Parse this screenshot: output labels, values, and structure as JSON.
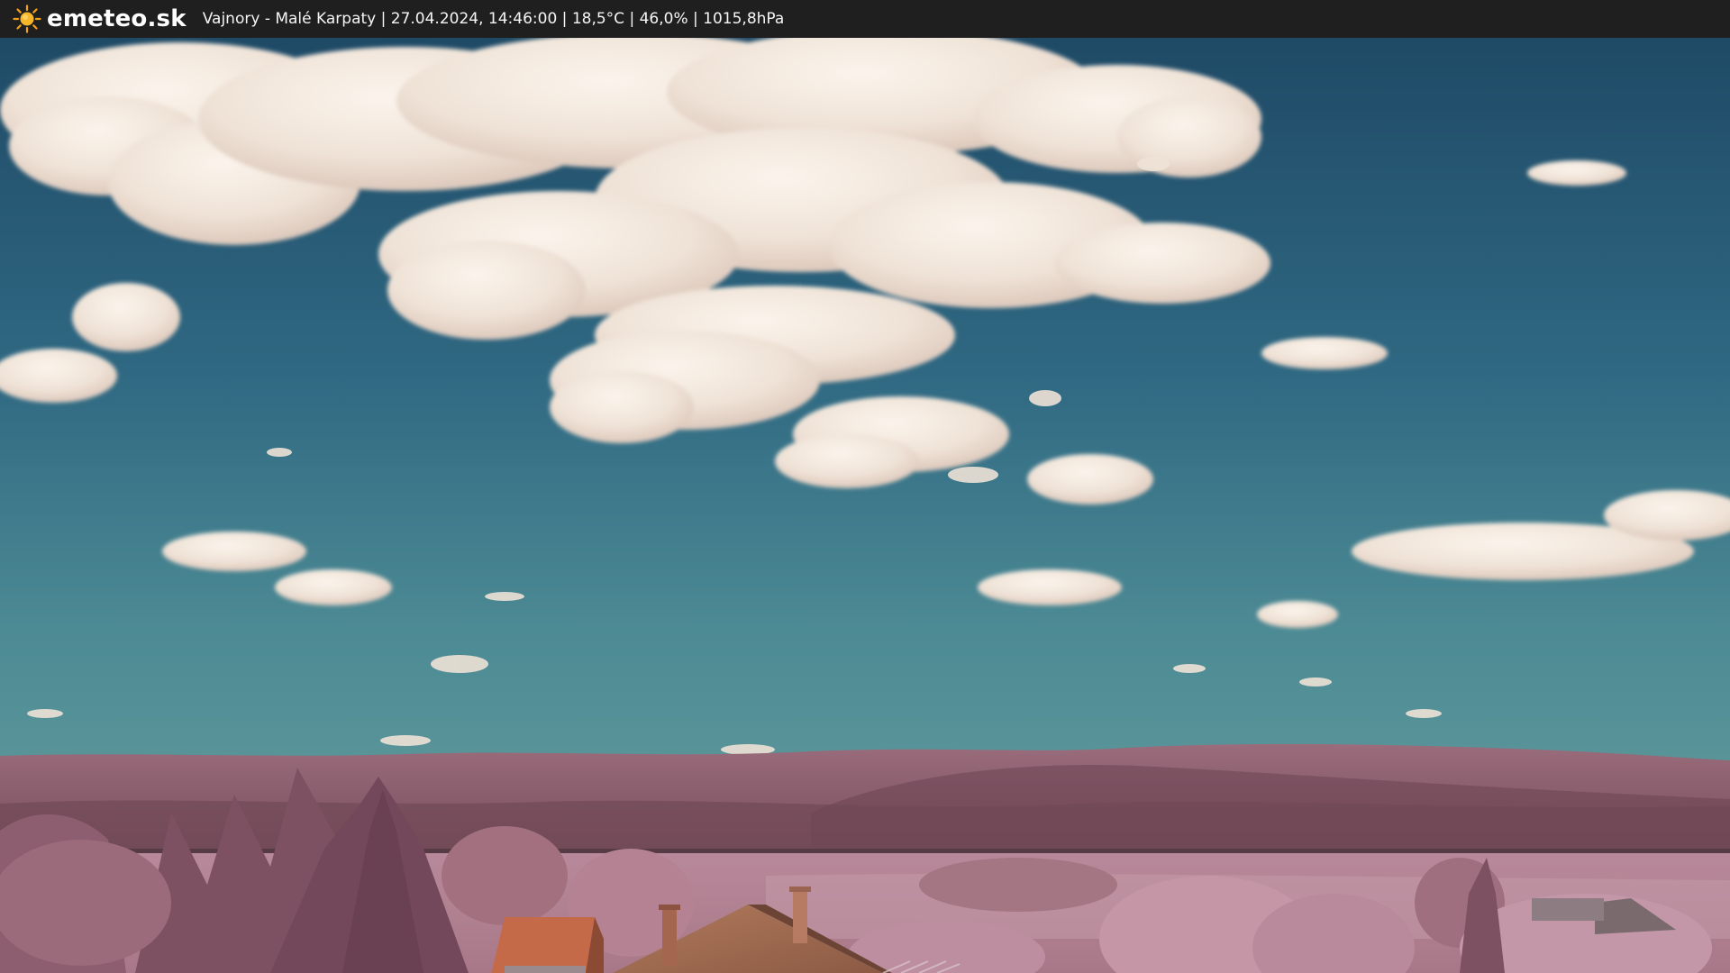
{
  "header": {
    "brand": "emeteo.sk",
    "location": "Vajnory - Malé Karpaty",
    "datetime": "27.04.2024, 14:46:00",
    "temperature": "18,5°C",
    "humidity": "46,0%",
    "pressure": "1015,8hPa",
    "separator": " | "
  },
  "icons": {
    "logo": "sun-icon"
  },
  "colors": {
    "bar_background": "#1f1f1f",
    "sun": "#f4a11a",
    "sky_top": "#23506a",
    "sky_bottom": "#4f8c95",
    "hills": "#8a5f6e",
    "foliage": "#b58596",
    "roof": "#c46a48"
  }
}
